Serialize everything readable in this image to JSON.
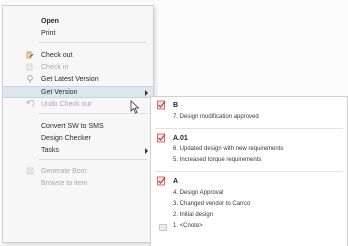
{
  "context_menu": {
    "items": [
      {
        "label": "Open",
        "icon": "",
        "state": "bold"
      },
      {
        "label": "Print",
        "icon": "",
        "state": "normal"
      },
      {
        "label": "Check out",
        "icon": "check-out-icon",
        "state": "normal"
      },
      {
        "label": "Check in",
        "icon": "check-in-icon",
        "state": "disabled"
      },
      {
        "label": "Get Latest Version",
        "icon": "get-latest-icon",
        "state": "normal"
      },
      {
        "label": "Get Version",
        "icon": "",
        "state": "highlighted",
        "submenu": true
      },
      {
        "label": "Undo Check out",
        "icon": "undo-icon",
        "state": "disabled"
      },
      {
        "label": "Convert SW to SMS",
        "icon": "",
        "state": "normal"
      },
      {
        "label": "Design Checker",
        "icon": "",
        "state": "normal"
      },
      {
        "label": "Tasks",
        "icon": "",
        "state": "normal",
        "submenu": true
      },
      {
        "label": "Generate Bom",
        "icon": "bom-icon",
        "state": "disabled"
      },
      {
        "label": "Browse to item",
        "icon": "",
        "state": "disabled"
      }
    ]
  },
  "submenu": {
    "versions": [
      {
        "label": "B",
        "comments": [
          "7. Design modification approved"
        ]
      },
      {
        "label": "A.01",
        "comments": [
          "6. Updated design with new requirements",
          "5. Increased torque requirements"
        ]
      },
      {
        "label": "A",
        "comments": [
          "4. Design Approval",
          "3. Changed vendor to Carrco",
          "2. Initial design",
          "1. <Cnote>"
        ]
      }
    ]
  },
  "colors": {
    "highlight": "#dfe6ee",
    "check_red": "#c0392b",
    "disabled_text": "#a8a8a8"
  }
}
